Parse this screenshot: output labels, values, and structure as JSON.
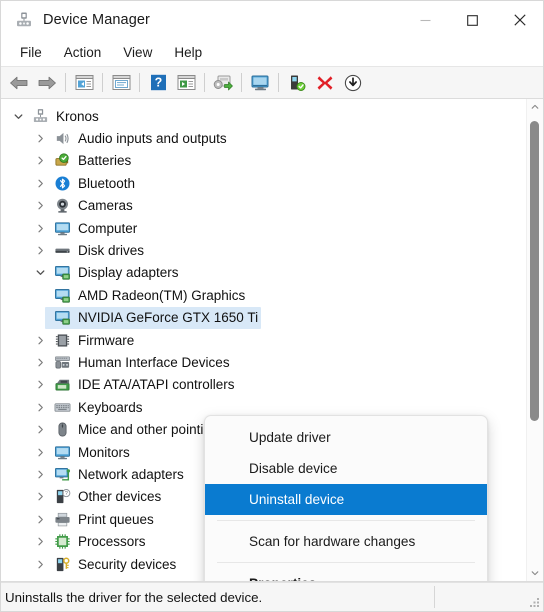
{
  "window": {
    "title": "Device Manager",
    "title_icon": "device-manager-icon",
    "controls": [
      {
        "name": "minimize-button",
        "glyph": "minimize"
      },
      {
        "name": "maximize-button",
        "glyph": "maximize"
      },
      {
        "name": "close-button",
        "glyph": "close"
      }
    ]
  },
  "menubar": {
    "items": [
      {
        "label": "File",
        "name": "menu-file"
      },
      {
        "label": "Action",
        "name": "menu-action"
      },
      {
        "label": "View",
        "name": "menu-view"
      },
      {
        "label": "Help",
        "name": "menu-help"
      }
    ]
  },
  "toolbar": {
    "buttons": [
      {
        "name": "back-button",
        "icon": "back-arrow-icon"
      },
      {
        "name": "forward-button",
        "icon": "forward-arrow-icon"
      },
      {
        "name": "show-hide-console-tree-button",
        "icon": "console-tree-icon"
      },
      {
        "name": "properties-button",
        "icon": "properties-window-icon"
      },
      {
        "name": "help-button",
        "icon": "question-mark-icon"
      },
      {
        "name": "show-hide-action-pane-button",
        "icon": "action-pane-icon"
      },
      {
        "name": "update-driver-button",
        "icon": "update-driver-icon"
      },
      {
        "name": "scan-hardware-changes-button",
        "icon": "scan-monitor-icon"
      },
      {
        "name": "disable-device-button",
        "icon": "disable-device-icon"
      },
      {
        "name": "uninstall-device-button",
        "icon": "red-x-icon"
      },
      {
        "name": "install-legacy-hardware-button",
        "icon": "download-circle-icon"
      }
    ]
  },
  "tree": {
    "root": {
      "label": "Kronos",
      "icon": "computer-node-icon",
      "expanded": true
    },
    "items": [
      {
        "label": "Audio inputs and outputs",
        "icon": "speaker-icon",
        "level": 1,
        "expanded": false,
        "selected": false
      },
      {
        "label": "Batteries",
        "icon": "battery-icon",
        "level": 1,
        "expanded": false,
        "selected": false
      },
      {
        "label": "Bluetooth",
        "icon": "bluetooth-icon",
        "level": 1,
        "expanded": false,
        "selected": false
      },
      {
        "label": "Cameras",
        "icon": "camera-icon",
        "level": 1,
        "expanded": false,
        "selected": false
      },
      {
        "label": "Computer",
        "icon": "monitor-icon",
        "level": 1,
        "expanded": false,
        "selected": false
      },
      {
        "label": "Disk drives",
        "icon": "disk-drive-icon",
        "level": 1,
        "expanded": false,
        "selected": false
      },
      {
        "label": "Display adapters",
        "icon": "display-adapter-icon",
        "level": 1,
        "expanded": true,
        "selected": false
      },
      {
        "label": "AMD Radeon(TM) Graphics",
        "icon": "display-adapter-icon",
        "level": 2,
        "expanded": false,
        "selected": false
      },
      {
        "label": "NVIDIA GeForce GTX 1650 Ti",
        "icon": "display-adapter-icon",
        "level": 2,
        "expanded": false,
        "selected": true
      },
      {
        "label": "Firmware",
        "icon": "firmware-icon",
        "level": 1,
        "expanded": false,
        "selected": false
      },
      {
        "label": "Human Interface Devices",
        "icon": "hid-icon",
        "level": 1,
        "expanded": false,
        "selected": false
      },
      {
        "label": "IDE ATA/ATAPI controllers",
        "icon": "ide-controller-icon",
        "level": 1,
        "expanded": false,
        "selected": false
      },
      {
        "label": "Keyboards",
        "icon": "keyboard-icon",
        "level": 1,
        "expanded": false,
        "selected": false
      },
      {
        "label": "Mice and other pointing devices",
        "icon": "mouse-icon",
        "level": 1,
        "expanded": false,
        "selected": false
      },
      {
        "label": "Monitors",
        "icon": "monitor-icon",
        "level": 1,
        "expanded": false,
        "selected": false
      },
      {
        "label": "Network adapters",
        "icon": "network-adapter-icon",
        "level": 1,
        "expanded": false,
        "selected": false
      },
      {
        "label": "Other devices",
        "icon": "other-device-icon",
        "level": 1,
        "expanded": false,
        "selected": false
      },
      {
        "label": "Print queues",
        "icon": "printer-icon",
        "level": 1,
        "expanded": false,
        "selected": false
      },
      {
        "label": "Processors",
        "icon": "processor-icon",
        "level": 1,
        "expanded": false,
        "selected": false
      },
      {
        "label": "Security devices",
        "icon": "security-device-icon",
        "level": 1,
        "expanded": false,
        "selected": false
      }
    ]
  },
  "context_menu": {
    "items": [
      {
        "label": "Update driver",
        "name": "ctx-update-driver",
        "highlight": false,
        "bold": false
      },
      {
        "label": "Disable device",
        "name": "ctx-disable-device",
        "highlight": false,
        "bold": false
      },
      {
        "label": "Uninstall device",
        "name": "ctx-uninstall-device",
        "highlight": true,
        "bold": false
      },
      {
        "label": "Scan for hardware changes",
        "name": "ctx-scan-hardware-changes",
        "highlight": false,
        "bold": false
      },
      {
        "label": "Properties",
        "name": "ctx-properties",
        "highlight": false,
        "bold": true
      }
    ]
  },
  "statusbar": {
    "text": "Uninstalls the driver for the selected device."
  },
  "colors": {
    "selection_blue": "#0a7bd0",
    "tree_selection": "#d8e8f7",
    "toolbar_bg": "#f6f6f6",
    "status_bg": "#f6f6f6",
    "accent_red": "#e02020",
    "accent_green": "#3a9a20"
  }
}
